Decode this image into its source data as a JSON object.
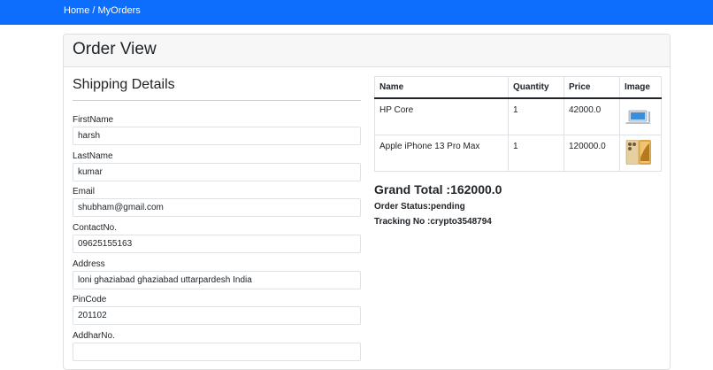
{
  "breadcrumb": {
    "home": "Home",
    "separator": " / ",
    "current": "MyOrders"
  },
  "page": {
    "title": "Order View"
  },
  "shipping": {
    "title": "Shipping Details",
    "fields": [
      {
        "label": "FirstName",
        "value": "harsh"
      },
      {
        "label": "LastName",
        "value": "kumar"
      },
      {
        "label": "Email",
        "value": "shubham@gmail.com"
      },
      {
        "label": "ContactNo.",
        "value": "09625155163"
      },
      {
        "label": "Address",
        "value": "loni ghaziabad ghaziabad uttarpardesh India"
      },
      {
        "label": "PinCode",
        "value": "201102"
      },
      {
        "label": "AddharNo.",
        "value": ""
      }
    ]
  },
  "order": {
    "columns": [
      "Name",
      "Quantity",
      "Price",
      "Image"
    ],
    "rows": [
      {
        "name": "HP Core",
        "quantity": "1",
        "price": "42000.0",
        "image": "laptop-image"
      },
      {
        "name": "Apple iPhone 13 Pro Max",
        "quantity": "1",
        "price": "120000.0",
        "image": "iphone-image"
      }
    ],
    "grand_total": "Grand Total :162000.0",
    "status": "Order Status:pending",
    "tracking": "Tracking No :crypto3548794"
  },
  "colors": {
    "topbar": "#0d6efd",
    "card_header": "#f7f7f7"
  }
}
